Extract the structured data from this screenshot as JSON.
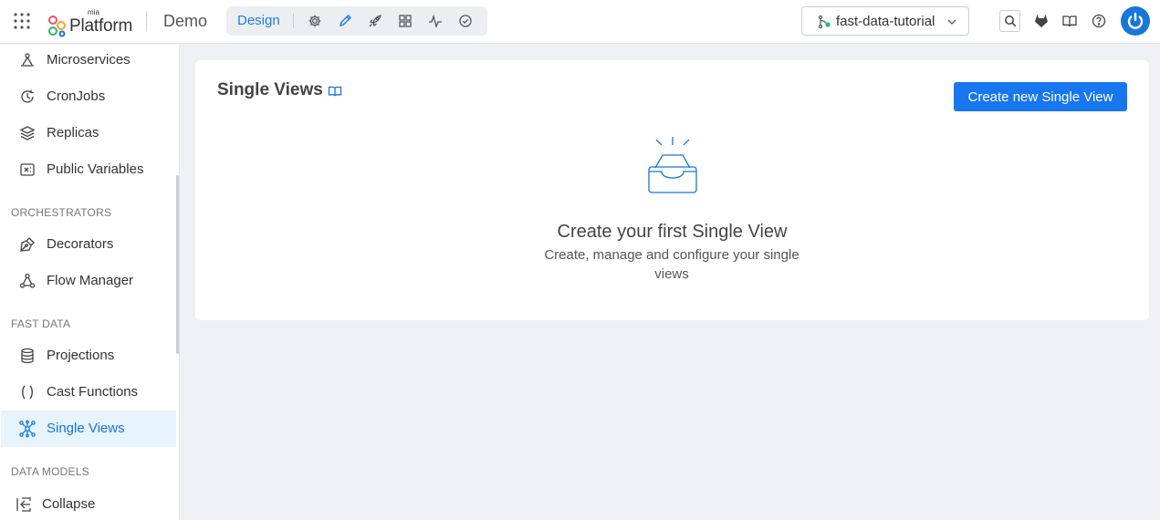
{
  "header": {
    "logo_small": "mia",
    "logo_text": "Platform",
    "project_name": "Demo",
    "mode_active": "Design",
    "mode_icons": [
      "gear-icon",
      "pencil-icon",
      "rocket-icon",
      "dashboard-icon",
      "activity-icon",
      "check-circle-icon"
    ],
    "branch": "fast-data-tutorial",
    "right_icons": [
      "search-icon",
      "gitlab-icon",
      "book-icon",
      "help-icon",
      "user-avatar-icon"
    ]
  },
  "sidebar": {
    "items_top": [
      {
        "label": "Microservices",
        "icon": "microservices-icon"
      },
      {
        "label": "CronJobs",
        "icon": "cronjob-icon"
      },
      {
        "label": "Replicas",
        "icon": "layers-icon"
      },
      {
        "label": "Public Variables",
        "icon": "variables-icon"
      }
    ],
    "section_orchestrators": "ORCHESTRATORS",
    "items_orchestrators": [
      {
        "label": "Decorators",
        "icon": "pen-tool-icon"
      },
      {
        "label": "Flow Manager",
        "icon": "flow-icon"
      }
    ],
    "section_fast_data": "FAST DATA",
    "items_fast_data": [
      {
        "label": "Projections",
        "icon": "database-icon"
      },
      {
        "label": "Cast Functions",
        "icon": "parentheses-icon"
      },
      {
        "label": "Single Views",
        "icon": "network-icon",
        "active": true
      }
    ],
    "section_data_models": "DATA MODELS",
    "collapse_label": "Collapse"
  },
  "main": {
    "title": "Single Views",
    "create_button": "Create new Single View",
    "empty_title": "Create your first Single View",
    "empty_description": "Create, manage and configure your single views"
  },
  "colors": {
    "accent": "#1677f0",
    "active_bg": "#e7f3fd",
    "page_bg": "#f0f1f4"
  }
}
